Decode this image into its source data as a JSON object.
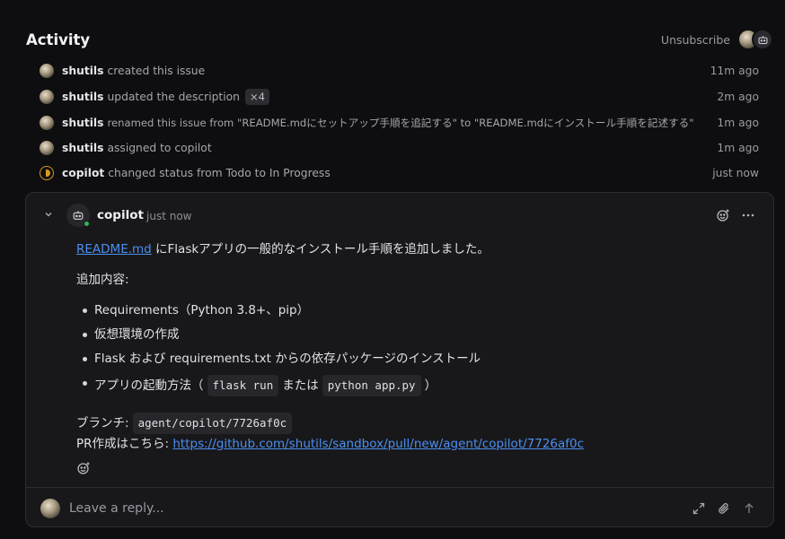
{
  "header": {
    "title": "Activity",
    "unsubscribe_label": "Unsubscribe"
  },
  "events": [
    {
      "actor": "shutils",
      "text": "created this issue",
      "badge": "",
      "time": "11m ago",
      "icon": "user-avatar"
    },
    {
      "actor": "shutils",
      "text": "updated the description",
      "badge": "×4",
      "time": "2m ago",
      "icon": "user-avatar"
    },
    {
      "actor": "shutils",
      "text": "renamed this issue from \"README.mdにセットアップ手順を追記する\" to \"README.mdにインストール手順を記述する\"",
      "badge": "",
      "time": "1m ago",
      "icon": "user-avatar"
    },
    {
      "actor": "shutils",
      "text": "assigned to copilot",
      "badge": "",
      "time": "1m ago",
      "icon": "user-avatar"
    },
    {
      "actor": "copilot",
      "text": "changed status from Todo to In Progress",
      "badge": "",
      "time": "just now",
      "icon": "in-progress-status-icon"
    }
  ],
  "comment": {
    "author": "copilot",
    "time": "just now",
    "intro_link": "README.md",
    "intro_rest": " にFlaskアプリの一般的なインストール手順を追加しました。",
    "additions_heading": "追加内容:",
    "bullets": {
      "b1": "Requirements（Python 3.8+、pip）",
      "b2": "仮想環境の作成",
      "b3": "Flask および requirements.txt からの依存パッケージのインストール",
      "b4_pre": "アプリの起動方法（",
      "b4_code1": "flask run",
      "b4_mid": "または",
      "b4_code2": "python app.py",
      "b4_post": "）"
    },
    "branch_label": "ブランチ:",
    "branch_name": "agent/copilot/7726af0c",
    "pr_label": "PR作成はこちら:",
    "pr_link": "https://github.com/shutils/sandbox/pull/new/agent/copilot/7726af0c"
  },
  "reply": {
    "placeholder": "Leave a reply..."
  },
  "colors": {
    "background": "#0e0e10",
    "card": "#18181b",
    "link": "#4b8ff0",
    "status": "#d99a1c",
    "online": "#2fb45a"
  }
}
